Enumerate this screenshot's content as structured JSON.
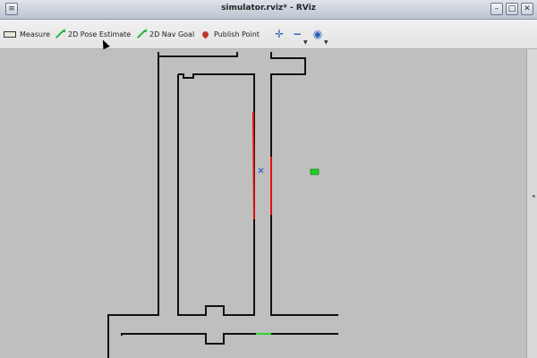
{
  "window": {
    "title": "simulator.rviz* - RViz"
  },
  "toolbar": {
    "measure_label": "Measure",
    "pose_estimate_label": "2D Pose Estimate",
    "nav_goal_label": "2D Nav Goal",
    "publish_point_label": "Publish Point"
  },
  "icons": {
    "measure": "ruler-icon",
    "pose": "green-arrow-icon",
    "nav": "green-arrow-icon",
    "publish": "map-pin-icon",
    "move_camera": "crosshair-move-icon",
    "zoom": "minus-icon",
    "view": "eye-icon"
  },
  "colors": {
    "background": "#bfbfbf",
    "wall": "#111111",
    "laser": "#e01010",
    "robot": "#1ed41e",
    "marker": "#2a5bd7"
  }
}
